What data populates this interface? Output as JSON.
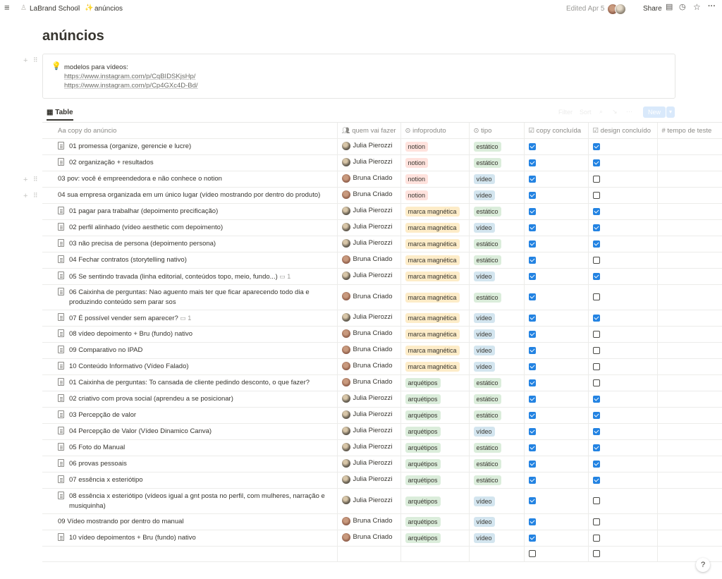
{
  "breadcrumb": {
    "workspace": "LaBrand School",
    "separator": "/",
    "page_icon": "✨",
    "page": "anúncios"
  },
  "topbar": {
    "edited": "Edited Apr 5",
    "share": "Share"
  },
  "page": {
    "title": "anúncios"
  },
  "callout": {
    "icon": "💡",
    "heading": "modelos para vídeos:",
    "links": [
      "https://www.instagram.com/p/CqBIDSKjsHp/",
      "https://www.instagram.com/p/Cp4GXc4D-Bd/"
    ]
  },
  "view": {
    "tab": "Table",
    "filter": "Filter",
    "sort": "Sort",
    "new": "New"
  },
  "columns": {
    "name": "Aa copy do anúncio",
    "who": "quem vai fazer",
    "product": "infoproduto",
    "type": "tipo",
    "copy_done": "copy concluída",
    "design_done": "design concluído",
    "time": "# tempo de teste"
  },
  "tag_colors": {
    "notion": "#ffe2dd",
    "marca magnética": "#fdecc8",
    "arquétipos": "#dbeddb",
    "estático": "#dbeddb",
    "vídeo": "#d3e5ef"
  },
  "rows": [
    {
      "name": "01 promessa (organize, gerencie e lucre)",
      "icon": true,
      "comments": "",
      "who": "Julia Pierozzi",
      "product": "notion",
      "type": "estático",
      "copy": true,
      "design": true
    },
    {
      "name": "02 organização + resultados",
      "icon": true,
      "comments": "",
      "who": "Julia Pierozzi",
      "product": "notion",
      "type": "estático",
      "copy": true,
      "design": true
    },
    {
      "name": "03 pov: você é empreendedora e não conhece o notion",
      "icon": false,
      "comments": "",
      "who": "Bruna Criado",
      "product": "notion",
      "type": "vídeo",
      "copy": true,
      "design": false
    },
    {
      "name": "04 sua empresa organizada em um único lugar (vídeo mostrando por dentro do produto)",
      "icon": false,
      "comments": "",
      "who": "Bruna Criado",
      "product": "notion",
      "type": "vídeo",
      "copy": true,
      "design": false
    },
    {
      "name": "01 pagar para trabalhar (depoimento precificação)",
      "icon": true,
      "comments": "",
      "who": "Julia Pierozzi",
      "product": "marca magnética",
      "type": "estático",
      "copy": true,
      "design": true
    },
    {
      "name": "02 perfil alinhado (vídeo aesthetic com depoimento)",
      "icon": true,
      "comments": "",
      "who": "Julia Pierozzi",
      "product": "marca magnética",
      "type": "vídeo",
      "copy": true,
      "design": true
    },
    {
      "name": "03 não precisa de persona (depoimento persona)",
      "icon": true,
      "comments": "",
      "who": "Julia Pierozzi",
      "product": "marca magnética",
      "type": "estático",
      "copy": true,
      "design": true
    },
    {
      "name": "04 Fechar contratos (storytelling nativo)",
      "icon": true,
      "comments": "",
      "who": "Bruna Criado",
      "product": "marca magnética",
      "type": "estático",
      "copy": true,
      "design": false
    },
    {
      "name": "05 Se sentindo travada (linha editorial, conteúdos topo, meio, fundo...)",
      "icon": true,
      "comments": "1",
      "who": "Julia Pierozzi",
      "product": "marca magnética",
      "type": "vídeo",
      "copy": true,
      "design": true
    },
    {
      "name": "06 Caixinha de perguntas: Nao aguento mais ter que ficar aparecendo todo dia e produzindo conteúdo sem parar sos",
      "icon": true,
      "comments": "",
      "who": "Bruna Criado",
      "product": "marca magnética",
      "type": "estático",
      "copy": true,
      "design": false,
      "tall": true
    },
    {
      "name": "07 É possível vender sem aparecer?",
      "icon": true,
      "comments": "1",
      "who": "Julia Pierozzi",
      "product": "marca magnética",
      "type": "vídeo",
      "copy": true,
      "design": true
    },
    {
      "name": "08 vídeo depoimento + Bru (fundo) nativo",
      "icon": true,
      "comments": "",
      "who": "Bruna Criado",
      "product": "marca magnética",
      "type": "vídeo",
      "copy": true,
      "design": false
    },
    {
      "name": "09 Comparativo no IPAD",
      "icon": true,
      "comments": "",
      "who": "Bruna Criado",
      "product": "marca magnética",
      "type": "vídeo",
      "copy": true,
      "design": false
    },
    {
      "name": "10 Conteúdo Informativo (Vídeo Falado)",
      "icon": true,
      "comments": "",
      "who": "Bruna Criado",
      "product": "marca magnética",
      "type": "vídeo",
      "copy": true,
      "design": false
    },
    {
      "name": "01 Caixinha de perguntas: To cansada de cliente pedindo desconto, o que fazer?",
      "icon": true,
      "comments": "",
      "who": "Bruna Criado",
      "product": "arquétipos",
      "type": "estático",
      "copy": true,
      "design": false
    },
    {
      "name": "02 criativo com prova social (aprendeu a se posicionar)",
      "icon": true,
      "comments": "",
      "who": "Julia Pierozzi",
      "product": "arquétipos",
      "type": "estático",
      "copy": true,
      "design": true
    },
    {
      "name": "03 Percepção de valor",
      "icon": true,
      "comments": "",
      "who": "Julia Pierozzi",
      "product": "arquétipos",
      "type": "estático",
      "copy": true,
      "design": true
    },
    {
      "name": "04 Percepção de Valor (Vídeo Dinamico Canva)",
      "icon": true,
      "comments": "",
      "who": "Julia Pierozzi",
      "product": "arquétipos",
      "type": "vídeo",
      "copy": true,
      "design": true
    },
    {
      "name": "05 Foto do Manual",
      "icon": true,
      "comments": "",
      "who": "Julia Pierozzi",
      "product": "arquétipos",
      "type": "estático",
      "copy": true,
      "design": true
    },
    {
      "name": "06 provas pessoais",
      "icon": true,
      "comments": "",
      "who": "Julia Pierozzi",
      "product": "arquétipos",
      "type": "estático",
      "copy": true,
      "design": true
    },
    {
      "name": "07 essência x esteriótipo",
      "icon": true,
      "comments": "",
      "who": "Julia Pierozzi",
      "product": "arquétipos",
      "type": "estático",
      "copy": true,
      "design": true
    },
    {
      "name": "08 essência x esteriótipo (vídeos igual a gnt posta no perfil, com mulheres, narração e musiquinha)",
      "icon": true,
      "comments": "",
      "who": "Julia Pierozzi",
      "product": "arquétipos",
      "type": "vídeo",
      "copy": true,
      "design": false,
      "tall": true
    },
    {
      "name": "09 Vídeo mostrando por dentro do manual",
      "icon": false,
      "comments": "",
      "who": "Bruna Criado",
      "product": "arquétipos",
      "type": "vídeo",
      "copy": true,
      "design": false
    },
    {
      "name": "10 vídeo depoimentos + Bru (fundo) nativo",
      "icon": true,
      "comments": "",
      "who": "Bruna Criado",
      "product": "arquétipos",
      "type": "vídeo",
      "copy": true,
      "design": false
    },
    {
      "name": "",
      "icon": false,
      "comments": "",
      "who": "",
      "product": "",
      "type": "",
      "copy": false,
      "design": false,
      "blank": true
    }
  ],
  "help": "?"
}
